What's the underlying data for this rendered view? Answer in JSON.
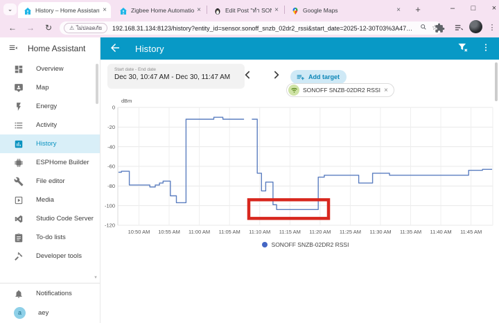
{
  "browser": {
    "tabs": [
      {
        "title": "History – Home Assistant",
        "favicon": "home-assistant",
        "active": true
      },
      {
        "title": "Zigbee Home Automation - ",
        "favicon": "home-assistant",
        "active": false
      },
      {
        "title": "Edit Post \"ทำ SONOFF Dong",
        "favicon": "penguin",
        "active": false
      },
      {
        "title": "Google Maps",
        "favicon": "google-maps",
        "active": false
      }
    ],
    "window_controls": {
      "minimize": "–",
      "maximize": "□",
      "close": "×"
    },
    "glyphs": {
      "tab_search": "⌄",
      "new_tab": "+",
      "back": "←",
      "forward": "→",
      "reload": "↻",
      "star": "☆",
      "dots": "⋮",
      "warning": "⚠",
      "close": "×",
      "scroll_arrow": "▾"
    },
    "security_chip": "ไม่ปลอดภัย",
    "url": "192.168.31.134:8123/history?entity_id=sensor.sonoff_snzb_02dr2_rssi&start_date=2025-12-30T03%3A47%3A..."
  },
  "sidebar": {
    "title": "Home Assistant",
    "items": [
      {
        "label": "Overview",
        "icon": "view-dashboard-icon",
        "active": false
      },
      {
        "label": "Map",
        "icon": "map-icon",
        "active": false
      },
      {
        "label": "Energy",
        "icon": "energy-icon",
        "active": false
      },
      {
        "label": "Activity",
        "icon": "activity-icon",
        "active": false
      },
      {
        "label": "History",
        "icon": "history-icon",
        "active": true
      },
      {
        "label": "ESPHome Builder",
        "icon": "esphome-icon",
        "active": false
      },
      {
        "label": "File editor",
        "icon": "file-editor-icon",
        "active": false
      },
      {
        "label": "Media",
        "icon": "media-icon",
        "active": false
      },
      {
        "label": "Studio Code Server",
        "icon": "studio-code-icon",
        "active": false
      },
      {
        "label": "To-do lists",
        "icon": "todo-icon",
        "active": false
      },
      {
        "label": "Developer tools",
        "icon": "developer-tools-icon",
        "active": false
      }
    ],
    "notifications_label": "Notifications",
    "user": {
      "name": "aey",
      "initial": "a"
    }
  },
  "header": {
    "title": "History"
  },
  "toolbar": {
    "date_range_label": "Start date - End date",
    "date_range_value": "Dec 30, 10:47 AM - Dec 30, 11:47 AM",
    "add_target_label": "Add target",
    "target_chip_label": "SONOFF SNZB-02DR2 RSSI"
  },
  "chart_data": {
    "type": "line",
    "title": "",
    "unit_label": "dBm",
    "ylabel": "dBm",
    "xlabel": "",
    "ylim": [
      -120,
      0
    ],
    "yticks": [
      0,
      -20,
      -40,
      -60,
      -80,
      -100,
      -120
    ],
    "x_domain_minutes_after_10am": [
      46.5,
      108.6
    ],
    "xticks": [
      {
        "t": 50,
        "label": "10:50 AM"
      },
      {
        "t": 55,
        "label": "10:55 AM"
      },
      {
        "t": 60,
        "label": "11:00 AM"
      },
      {
        "t": 65,
        "label": "11:05 AM"
      },
      {
        "t": 70,
        "label": "11:10 AM"
      },
      {
        "t": 75,
        "label": "11:15 AM"
      },
      {
        "t": 80,
        "label": "11:20 AM"
      },
      {
        "t": 85,
        "label": "11:25 AM"
      },
      {
        "t": 90,
        "label": "11:30 AM"
      },
      {
        "t": 95,
        "label": "11:35 AM"
      },
      {
        "t": 100,
        "label": "11:40 AM"
      },
      {
        "t": 105,
        "label": "11:45 AM"
      }
    ],
    "grid": true,
    "legend_position": "bottom",
    "series": [
      {
        "name": "SONOFF SNZB-02DR2 RSSI",
        "color": "#5b7ec0",
        "segments": [
          [
            [
              46.6,
              -66
            ],
            [
              47.1,
              -66
            ],
            [
              47.1,
              -65
            ],
            [
              48.4,
              -65
            ],
            [
              48.4,
              -79
            ],
            [
              51.8,
              -79
            ],
            [
              51.8,
              -81
            ],
            [
              52.7,
              -81
            ],
            [
              52.7,
              -79
            ],
            [
              53.4,
              -79
            ],
            [
              53.4,
              -77
            ],
            [
              54,
              -77
            ],
            [
              54,
              -75
            ],
            [
              55.2,
              -75
            ],
            [
              55.2,
              -90
            ],
            [
              56.2,
              -90
            ],
            [
              56.2,
              -97
            ],
            [
              57.8,
              -97
            ],
            [
              57.8,
              -12
            ],
            [
              62.4,
              -12
            ],
            [
              62.4,
              -10
            ],
            [
              63.9,
              -10
            ],
            [
              63.9,
              -12
            ],
            [
              67.4,
              -12
            ]
          ],
          [
            [
              68.7,
              -12
            ],
            [
              69.6,
              -12
            ],
            [
              69.6,
              -67
            ],
            [
              70.3,
              -67
            ],
            [
              70.3,
              -85
            ],
            [
              71,
              -85
            ],
            [
              71,
              -76
            ],
            [
              72.2,
              -76
            ],
            [
              72.2,
              -99
            ],
            [
              72.8,
              -99
            ],
            [
              72.8,
              -104
            ],
            [
              79.7,
              -104
            ],
            [
              79.7,
              -71
            ],
            [
              80.7,
              -71
            ],
            [
              80.7,
              -69
            ],
            [
              86.4,
              -69
            ],
            [
              86.4,
              -77
            ],
            [
              88.7,
              -77
            ],
            [
              88.7,
              -67
            ],
            [
              91.5,
              -67
            ],
            [
              91.5,
              -69
            ],
            [
              104.6,
              -69
            ],
            [
              104.6,
              -64
            ],
            [
              106.9,
              -64
            ],
            [
              106.9,
              -63
            ],
            [
              108.5,
              -63
            ]
          ]
        ]
      }
    ],
    "annotation_box": {
      "t1": 68.2,
      "t2": 81.4,
      "v1": -94,
      "v2": -113,
      "color": "#d8281f"
    }
  },
  "colors": {
    "app_header": "#0899c6",
    "active_item": "#0a93c0",
    "active_item_bg": "#d9eff8",
    "line": "#5b7ec0",
    "legend_dot": "#4466c4",
    "annotation": "#d8281f",
    "tabstrip_bg": "#f6e3f2"
  }
}
